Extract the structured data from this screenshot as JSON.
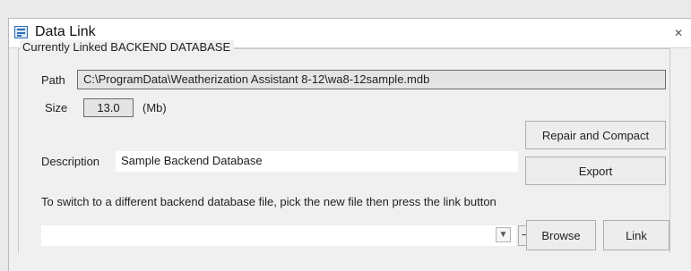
{
  "window": {
    "title": "Data Link",
    "close_glyph": "✕",
    "title_icon": "form-icon"
  },
  "group": {
    "legend": "Currently Linked BACKEND DATABASE"
  },
  "path": {
    "label": "Path",
    "value": "C:\\ProgramData\\Weatherization Assistant 8-12\\wa8-12sample.mdb"
  },
  "size": {
    "label": "Size",
    "value": "13.0",
    "unit": "(Mb)"
  },
  "description": {
    "label": "Description",
    "value": "Sample Backend Database"
  },
  "buttons": {
    "repair": "Repair and Compact",
    "export": "Export",
    "browse": "Browse",
    "link": "Link",
    "clear": "—"
  },
  "instruction": "To switch to a different backend database file, pick the new file then press the link button",
  "file_picker": {
    "value": "",
    "arrow_icon": "chevron-down-icon"
  }
}
